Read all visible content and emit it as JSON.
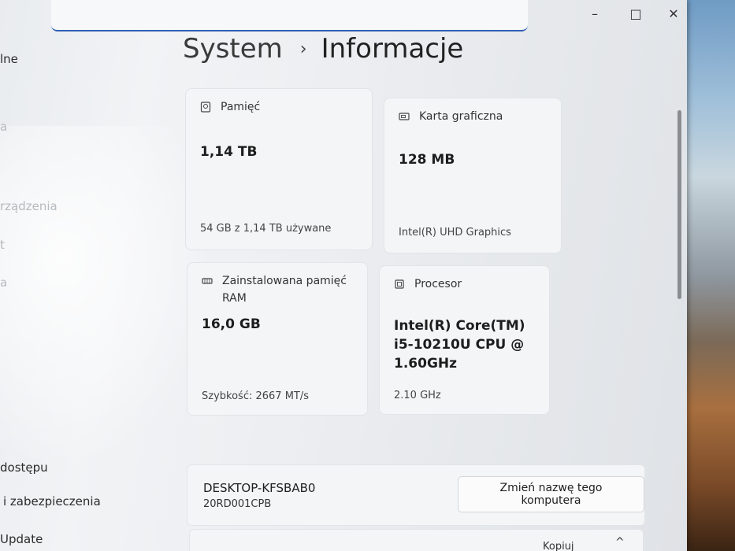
{
  "sidebar": {
    "items": [
      {
        "label": "lne"
      },
      {
        "label": "a"
      },
      {
        "label": "rządzenia"
      },
      {
        "label": "t"
      },
      {
        "label": "a"
      },
      {
        "label": "dostępu"
      },
      {
        "label": "i zabezpieczenia"
      },
      {
        "label": "Update"
      }
    ]
  },
  "breadcrumb": {
    "parent": "System",
    "separator": "›",
    "current": "Informacje"
  },
  "window_controls": {
    "minimize": "–",
    "maximize": "□",
    "close": "✕"
  },
  "cards": {
    "storage": {
      "label": "Pamięć",
      "value": "1,14 TB",
      "sub": "54 GB z 1,14 TB używane",
      "icon": "storage-icon"
    },
    "gpu": {
      "label": "Karta graficzna",
      "value": "128 MB",
      "sub": "Intel(R) UHD Graphics",
      "icon": "display-adapter-icon"
    },
    "ram": {
      "label_line1": "Zainstalowana pamięć",
      "label_line2": "RAM",
      "value": "16,0 GB",
      "sub": "Szybkość: 2667 MT/s",
      "icon": "ram-icon"
    },
    "cpu": {
      "label": "Procesor",
      "value_line1": "Intel(R) Core(TM)",
      "value_line2": "i5-10210U CPU @",
      "value_line3": "1.60GHz",
      "sub": "2.10 GHz",
      "icon": "processor-icon"
    }
  },
  "device": {
    "name": "DESKTOP-KFSBAB0",
    "model": "20RD001CPB",
    "rename_label": "Zmień nazwę tego komputera"
  },
  "specs": {
    "copy_label": "Kopiuj",
    "chevron": "^"
  }
}
